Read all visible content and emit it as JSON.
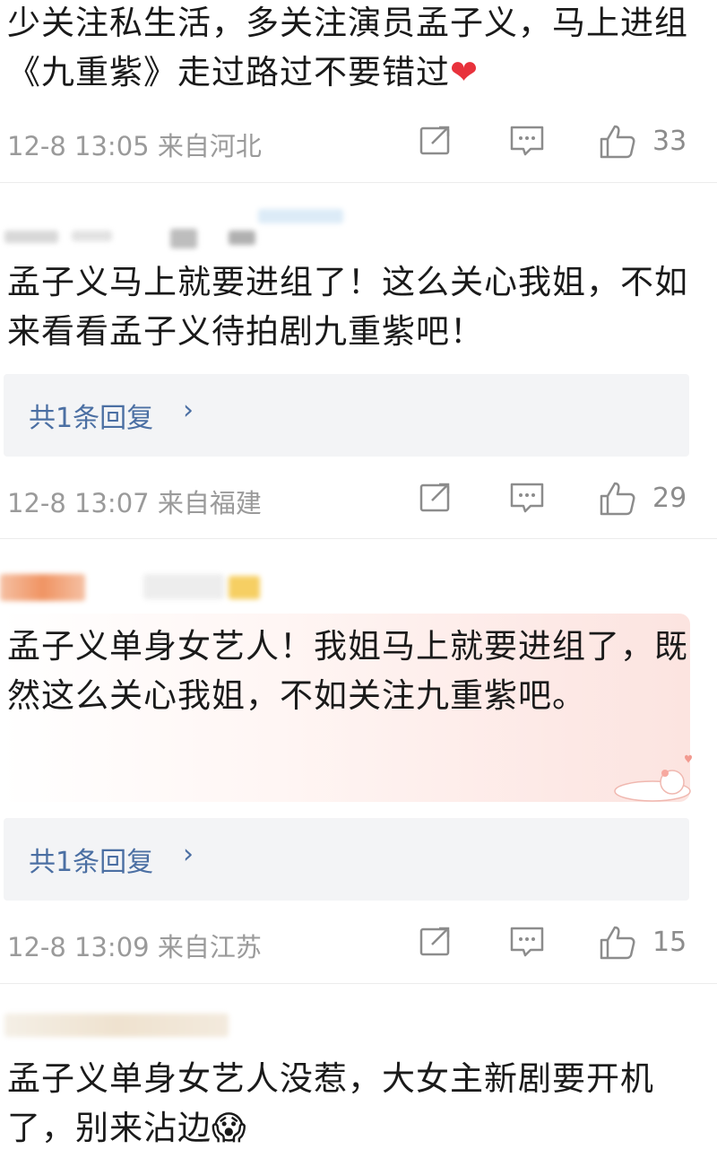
{
  "comments": [
    {
      "text": "少关注私生活，多关注演员孟子义，马上进组《九重紫》走过路过不要错过",
      "heart": "❤",
      "time": "12-8 13:05 来自河北",
      "likes": "33"
    },
    {
      "text": "孟子义马上就要进组了！这么关心我姐，不如来看看孟子义待拍剧九重紫吧！",
      "replies": "共1条回复",
      "time": "12-8 13:07 来自福建",
      "likes": "29"
    },
    {
      "text": "孟子义单身女艺人！我姐马上就要进组了，既然这么关心我姐，不如关注九重紫吧。",
      "replies": "共1条回复",
      "time": "12-8 13:09 来自江苏",
      "likes": "15"
    },
    {
      "text": "孟子义单身女艺人没惹，大女主新剧要开机了，别来沾边",
      "emoji": "😱"
    }
  ],
  "icons": {
    "share": "share-icon",
    "reply": "comment-icon",
    "like": "thumbs-up-icon"
  },
  "colors": {
    "link": "#4b6fa3",
    "meta": "#9a9a9a",
    "heart": "#e8323c"
  }
}
